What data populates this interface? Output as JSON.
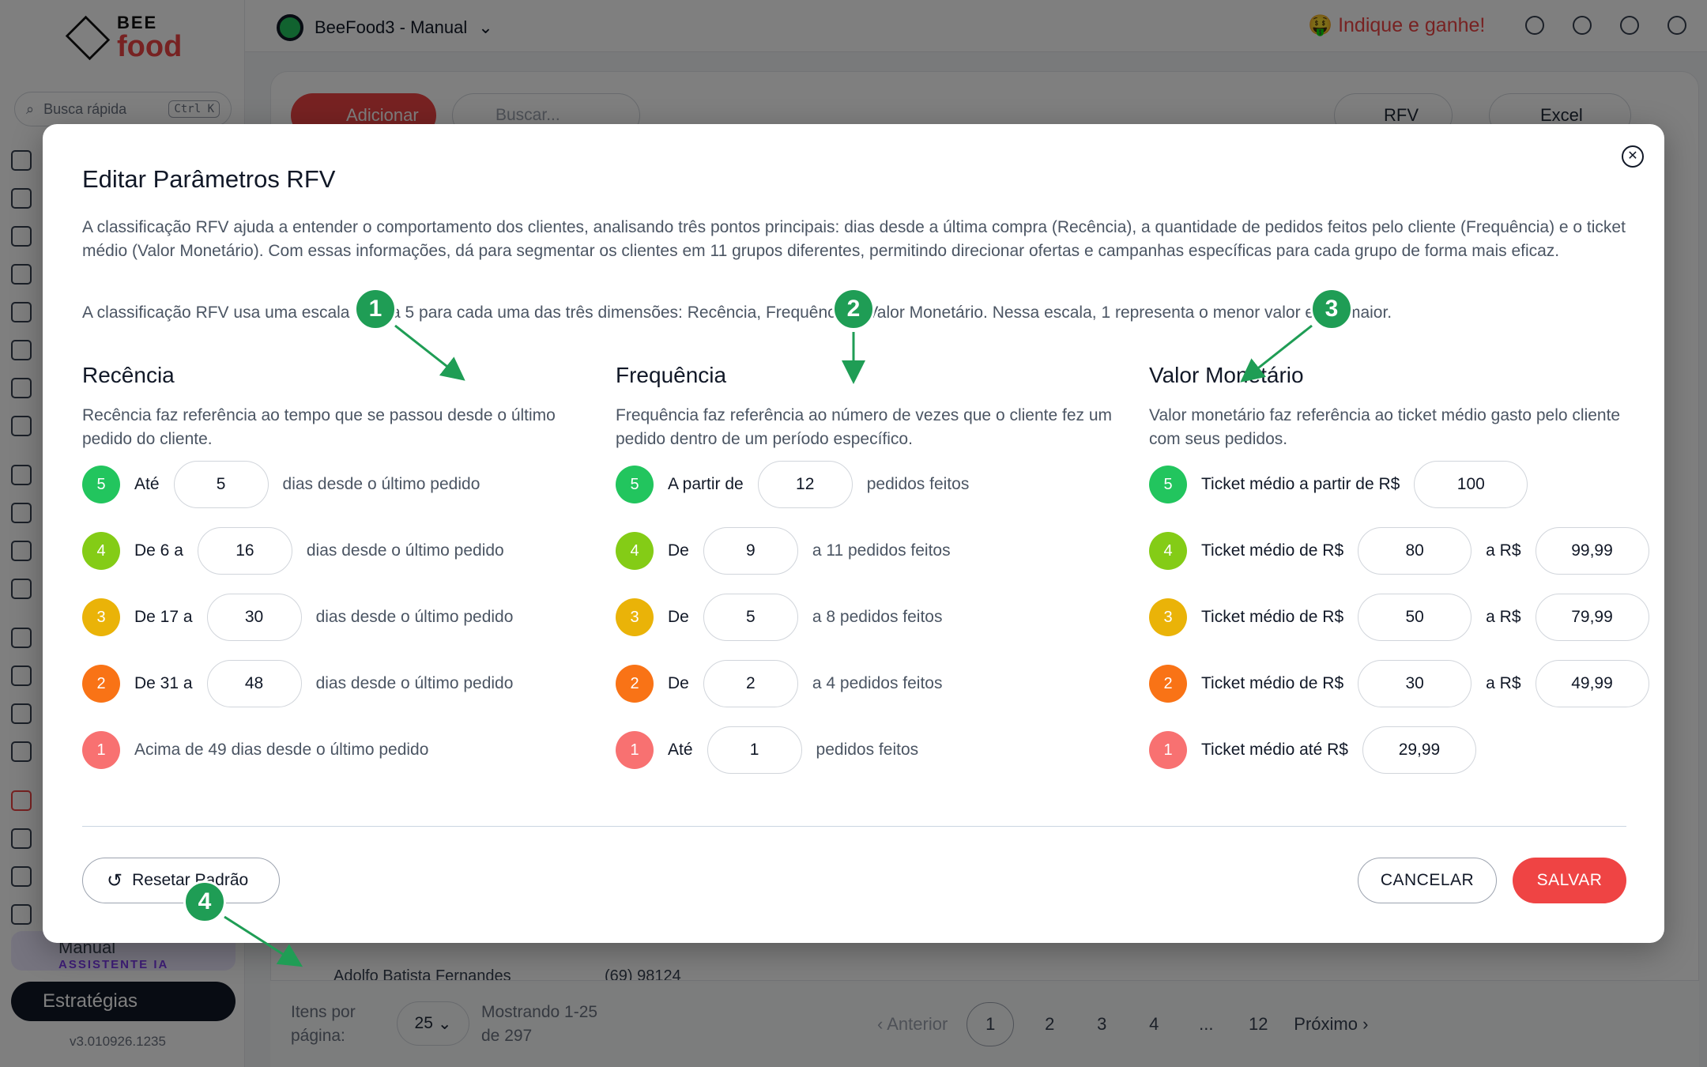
{
  "sidebar": {
    "brand_top": "BEE",
    "brand_bottom": "food",
    "quick_search_placeholder": "Busca rápida",
    "quick_search_shortcut": "Ctrl K",
    "assistant_title": "Manual",
    "assistant_subtitle": "ASSISTENTE IA",
    "strategies_label": "Estratégias",
    "version": "v3.010926.1235"
  },
  "topbar": {
    "store_name": "BeeFood3 - Manual",
    "refer_label": "🤑 Indique e ganhe!"
  },
  "background": {
    "add_label": "Adicionar",
    "search_placeholder": "Buscar...",
    "rfv_label": "RFV",
    "excel_label": "Excel",
    "row_name": "Adolfo Batista Fernandes",
    "row_phone": "(69) 98124",
    "items_per_page_label": "Itens por página:",
    "items_per_page_value": "25",
    "showing_label": "Mostrando 1-25 de 297",
    "prev_label": "Anterior",
    "pages": [
      "1",
      "2",
      "3",
      "4",
      "...",
      "12"
    ],
    "next_label": "Próximo"
  },
  "modal": {
    "title": "Editar Parâmetros RFV",
    "description_1": "A classificação RFV ajuda a entender o comportamento dos clientes, analisando três pontos principais: dias desde a última compra (Recência), a quantidade de pedidos feitos pelo cliente (Frequência) e o ticket médio (Valor Monetário). Com essas informações, dá para segmentar os clientes em 11 grupos diferentes, permitindo direcionar ofertas e campanhas específicas para cada grupo de forma mais eficaz.",
    "description_2": "A classificação RFV usa uma escala de 1 a 5 para cada uma das três dimensões: Recência, Frequência e Valor Monetário. Nessa escala, 1 representa o menor valor e 5 o maior.",
    "recency": {
      "title": "Recência",
      "description": "Recência faz referência ao tempo que se passou desde o último pedido do cliente.",
      "rows": [
        {
          "score": "5",
          "prefix": "Até",
          "value": "5",
          "suffix": "dias desde o último pedido"
        },
        {
          "score": "4",
          "prefix": "De 6 a",
          "value": "16",
          "suffix": "dias desde o último pedido"
        },
        {
          "score": "3",
          "prefix": "De 17 a",
          "value": "30",
          "suffix": "dias desde o último pedido"
        },
        {
          "score": "2",
          "prefix": "De 31 a",
          "value": "48",
          "suffix": "dias desde o último pedido"
        },
        {
          "score": "1",
          "text": "Acima de 49 dias desde o último pedido"
        }
      ]
    },
    "frequency": {
      "title": "Frequência",
      "description": "Frequência faz referência ao número de vezes que o cliente fez um pedido dentro de um período específico.",
      "rows": [
        {
          "score": "5",
          "prefix": "A partir de",
          "value": "12",
          "suffix": "pedidos feitos"
        },
        {
          "score": "4",
          "prefix": "De",
          "value": "9",
          "suffix": "a 11 pedidos feitos"
        },
        {
          "score": "3",
          "prefix": "De",
          "value": "5",
          "suffix": "a 8 pedidos feitos"
        },
        {
          "score": "2",
          "prefix": "De",
          "value": "2",
          "suffix": "a 4 pedidos feitos"
        },
        {
          "score": "1",
          "prefix": "Até",
          "value": "1",
          "suffix": "pedidos feitos"
        }
      ]
    },
    "monetary": {
      "title": "Valor Monetário",
      "description": "Valor monetário faz referência ao ticket médio gasto pelo cliente com seus pedidos.",
      "rows": [
        {
          "score": "5",
          "prefix": "Ticket médio a partir de R$",
          "value": "100"
        },
        {
          "score": "4",
          "prefix": "Ticket médio de R$",
          "value": "80",
          "middle": "a R$",
          "value2": "99,99"
        },
        {
          "score": "3",
          "prefix": "Ticket médio de R$",
          "value": "50",
          "middle": "a R$",
          "value2": "79,99"
        },
        {
          "score": "2",
          "prefix": "Ticket médio de R$",
          "value": "30",
          "middle": "a R$",
          "value2": "49,99"
        },
        {
          "score": "1",
          "prefix": "Ticket médio até R$",
          "value": "29,99"
        }
      ]
    },
    "reset_label": "Resetar Padrão",
    "cancel_label": "CANCELAR",
    "save_label": "SALVAR"
  },
  "annotations": [
    "1",
    "2",
    "3",
    "4"
  ],
  "colors": {
    "accent": "#ef4444",
    "score_5": "#22c55e",
    "score_4": "#84cc16",
    "score_3": "#eab308",
    "score_2": "#f97316",
    "score_1": "#f87171",
    "marker": "#1f9d55"
  }
}
